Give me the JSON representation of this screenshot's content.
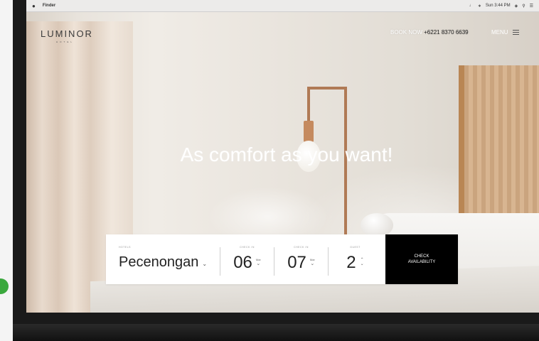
{
  "menubar": {
    "apple_icon": "apple-icon",
    "app_name": "Finder",
    "status": "Sun 3:44 PM"
  },
  "header": {
    "logo": "LUMINOR",
    "logo_sub": "HOTEL",
    "book_label": "BOOK NOW",
    "phone": "+6221 8370 6639",
    "menu_label": "MENU"
  },
  "hero": {
    "headline": "As comfort as you want!"
  },
  "booking": {
    "hotel_label": "HOTELS",
    "hotel_value": "Pecenongan",
    "checkin_label": "CHECK IN",
    "checkin_day": "06",
    "checkin_month": "Mar",
    "checkout_label": "CHECK IN",
    "checkout_day": "07",
    "checkout_month": "Mar",
    "guest_label": "GUEST",
    "guest_value": "2",
    "cta_line1": "CHECK",
    "cta_line2": "AVAILABILITY"
  },
  "colors": {
    "cta_bg": "#000000",
    "accent_green": "#3aa83d"
  }
}
